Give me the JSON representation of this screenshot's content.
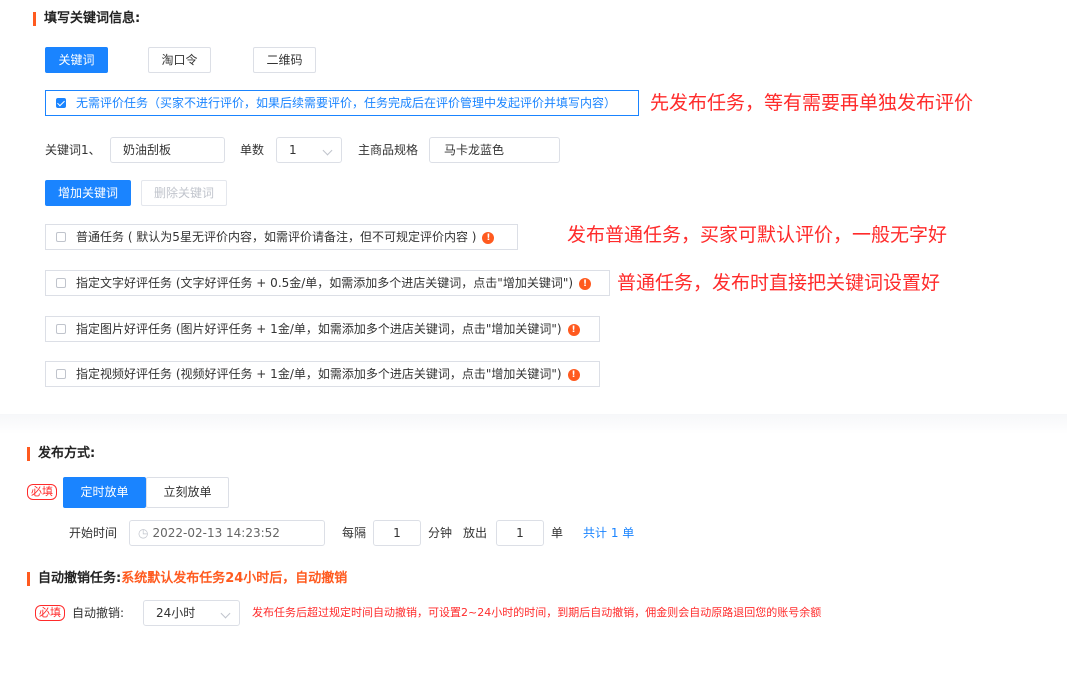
{
  "keyword_section": {
    "title": "填写关键词信息:",
    "tabs": [
      {
        "label": "关键词",
        "active": true
      },
      {
        "label": "淘口令",
        "active": false
      },
      {
        "label": "二维码",
        "active": false
      }
    ],
    "no_review_checkbox": {
      "label": "无需评价任务（买家不进行评价，如果后续需要评价，任务完成后在评价管理中发起评价并填写内容）",
      "checked": true
    },
    "annotation_1": "先发布任务，等有需要再单独发布评价",
    "keyword_label": "关键词1、",
    "keyword_value": "奶油刮板",
    "quantity_label": "单数",
    "quantity_value": "1",
    "spec_label": "主商品规格",
    "spec_value": "马卡龙蓝色",
    "add_keyword_button": "增加关键词",
    "delete_keyword_button": "删除关键词",
    "task_options": [
      {
        "label": "普通任务 ( 默认为5星无评价内容，如需评价请备注，但不可规定评价内容 )",
        "checked": false
      },
      {
        "label": "指定文字好评任务 (文字好评任务 + 0.5金/单，如需添加多个进店关键词，点击\"增加关键词\")",
        "checked": false
      },
      {
        "label": "指定图片好评任务 (图片好评任务 + 1金/单，如需添加多个进店关键词，点击\"增加关键词\")",
        "checked": false
      },
      {
        "label": "指定视频好评任务 (视频好评任务 + 1金/单，如需添加多个进店关键词，点击\"增加关键词\")",
        "checked": false
      }
    ],
    "annotation_2": "发布普通任务，买家可默认评价，一般无字好",
    "annotation_3": "普通任务，发布时直接把关键词设置好"
  },
  "publish_section": {
    "title": "发布方式:",
    "required": "必填",
    "tabs": [
      {
        "label": "定时放单",
        "active": true
      },
      {
        "label": "立刻放单",
        "active": false
      }
    ],
    "start_time_label": "开始时间",
    "start_time_value": "2022-02-13 14:23:52",
    "interval_label": "每隔",
    "interval_value": "1",
    "minute_label": "分钟",
    "release_label": "放出",
    "release_value": "1",
    "unit_label": "单",
    "total_text": "共计 1 单"
  },
  "auto_cancel_section": {
    "title": "自动撤销任务:",
    "subtitle": "系统默认发布任务24小时后，自动撤销",
    "required": "必填",
    "label": "自动撤销:",
    "select_value": "24小时",
    "note": "发布任务后超过规定时间自动撤销，可设置2~24小时的时间，到期后自动撤销，佣金则会自动原路退回您的账号余额"
  },
  "colors": {
    "primary": "#1a84ff",
    "accent": "#ff5a1f",
    "annotation": "#ff2b2b"
  },
  "icons": {
    "warning": "warning-icon",
    "clock": "clock-icon",
    "chevron": "chevron-down-icon"
  }
}
